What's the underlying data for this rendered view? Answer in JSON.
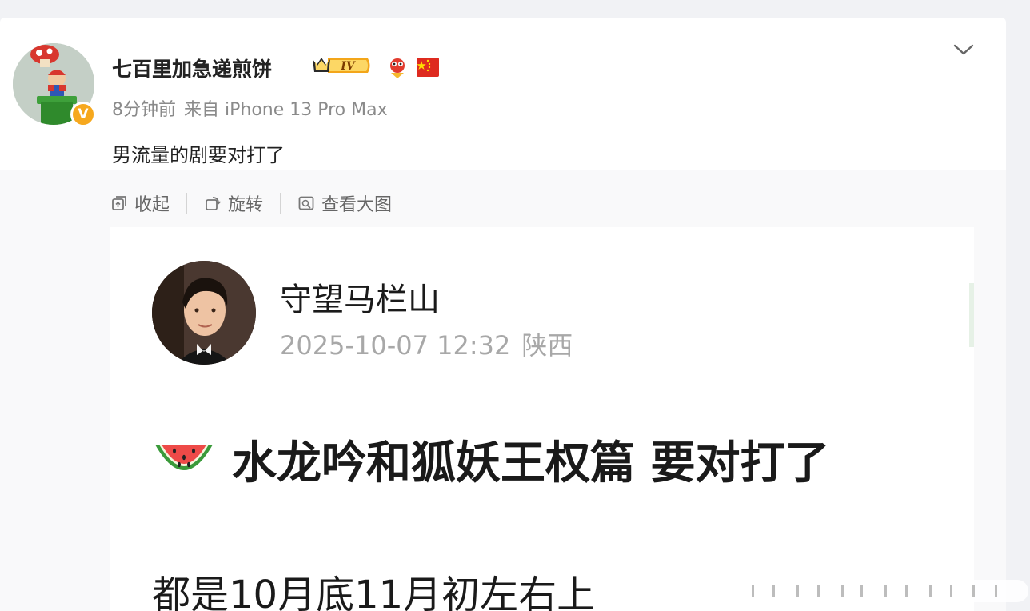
{
  "post": {
    "author": "七百里加急递煎饼",
    "level_badge": "IV",
    "verified_mark": "V",
    "time": "8分钟前",
    "source": "来自 iPhone 13 Pro Max",
    "text": "男流量的剧要对打了",
    "more_icon": "chevron-down-icon",
    "badges": [
      "crown-level-icon",
      "mascot-icon",
      "china-flag-icon"
    ]
  },
  "toolbar": {
    "collapse_label": "收起",
    "rotate_label": "旋转",
    "view_large_label": "查看大图"
  },
  "image": {
    "author": "守望马栏山",
    "datetime": "2025-10-07 12:32",
    "location": "陕西",
    "emoji": "watermelon",
    "headline": "水龙吟和狐妖王权篇 要对打了",
    "body": "都是10月底11月初左右上"
  },
  "colors": {
    "page_bg": "#f1f2f5",
    "media_bg": "#f9f9fa",
    "verified": "#f6a81e",
    "level_badge": "#f3a61a",
    "meta_text": "#8a8a8a"
  }
}
